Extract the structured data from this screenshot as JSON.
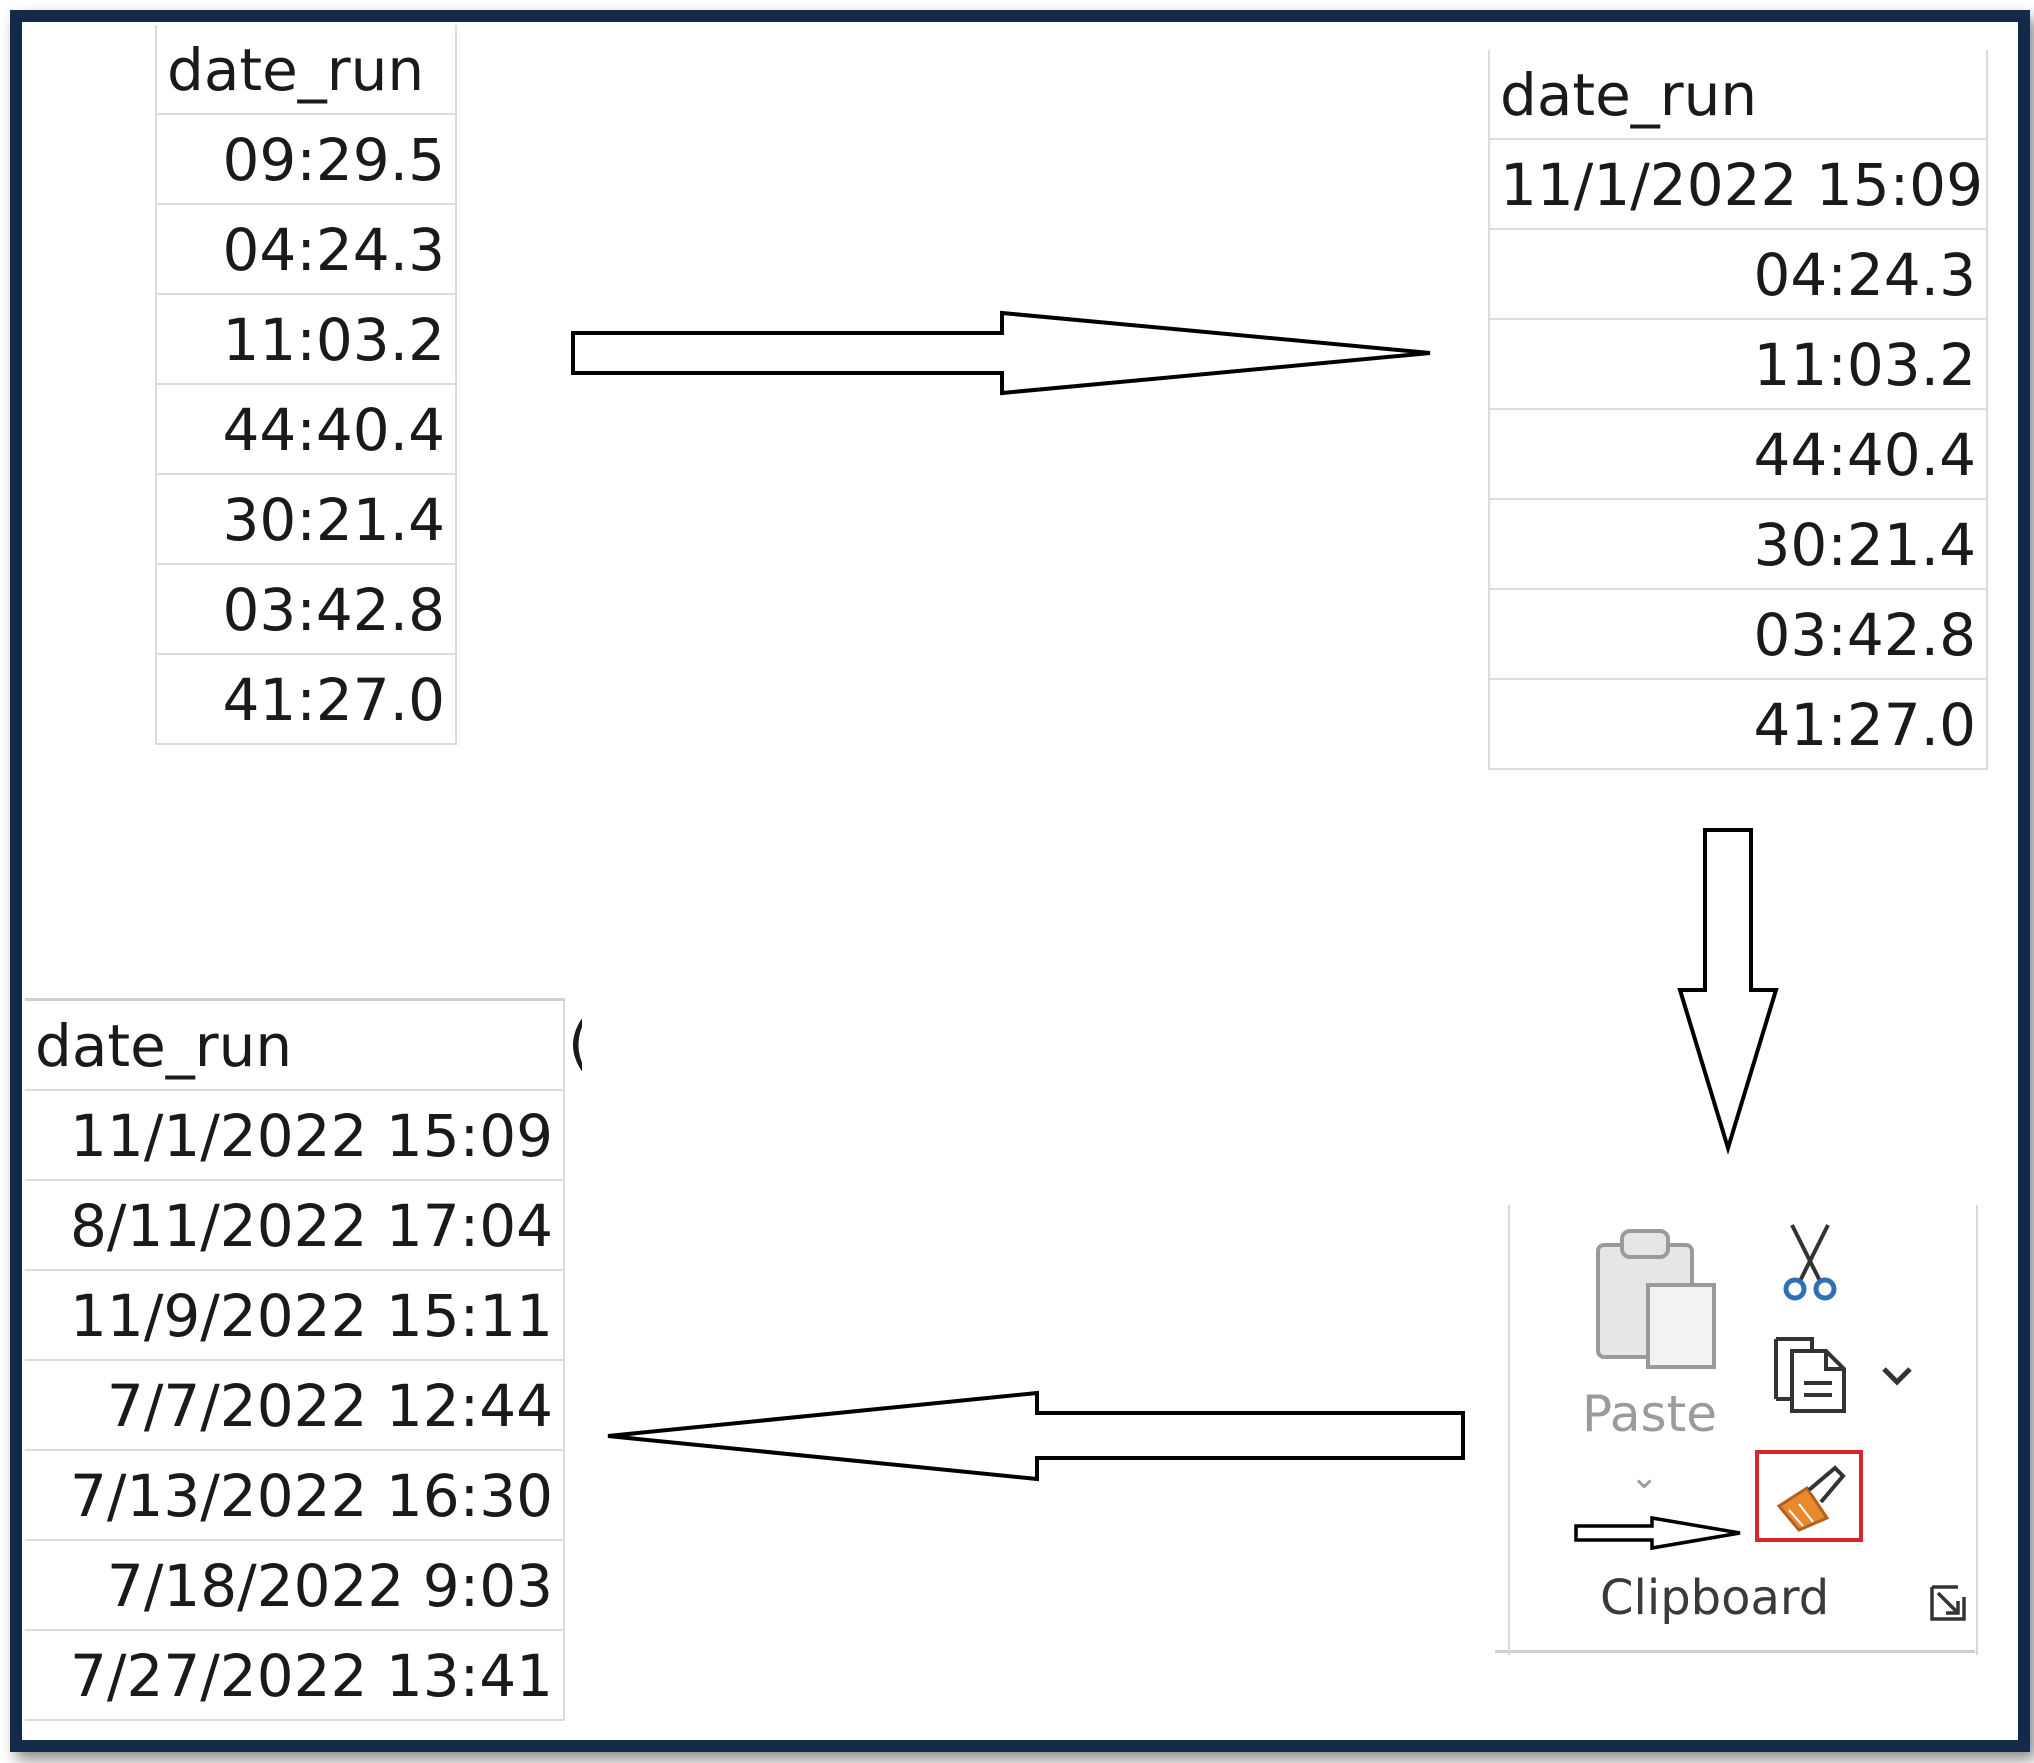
{
  "sheet_before": {
    "header": "date_run",
    "rows": [
      "09:29.5",
      "04:24.3",
      "11:03.2",
      "44:40.4",
      "30:21.4",
      "03:42.8",
      "41:27.0"
    ]
  },
  "sheet_middle": {
    "header": "date_run",
    "rows": [
      "11/1/2022 15:09",
      "04:24.3",
      "11:03.2",
      "44:40.4",
      "30:21.4",
      "03:42.8",
      "41:27.0"
    ]
  },
  "sheet_after": {
    "header": "date_run",
    "partial_next_header": "(",
    "rows": [
      "11/1/2022 15:09",
      "8/11/2022 17:04",
      "11/9/2022 15:11",
      "7/7/2022 12:44",
      "7/13/2022 16:30",
      "7/18/2022 9:03",
      "7/27/2022 13:41"
    ]
  },
  "clipboard": {
    "paste_label": "Paste",
    "paste_chevron": "⌄",
    "group_label": "Clipboard",
    "icons": [
      "paste-icon",
      "cut-icon",
      "copy-icon",
      "copy-dropdown-icon",
      "format-painter-icon",
      "dialog-launcher-icon"
    ]
  },
  "colors": {
    "frame": "#142a4a",
    "highlight": "#d9262a",
    "format_painter": "#e8892c",
    "scissors": "#2f6fb3"
  }
}
